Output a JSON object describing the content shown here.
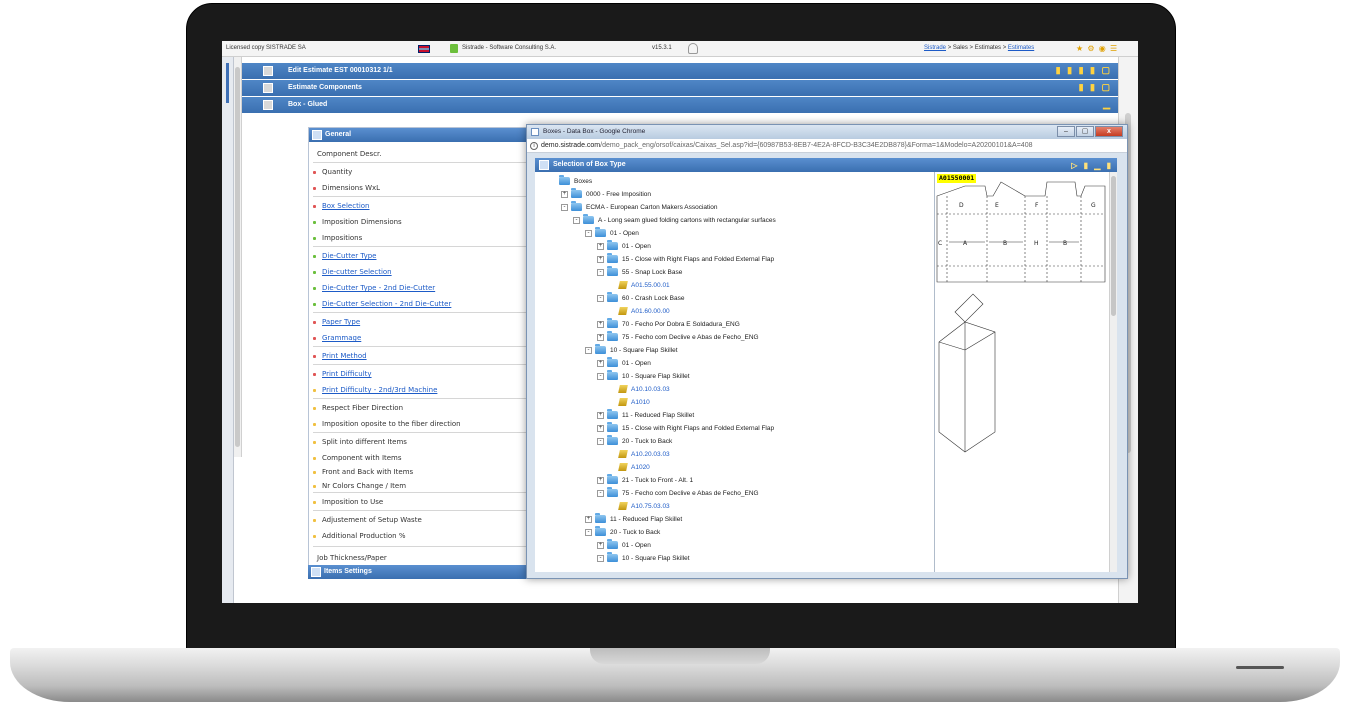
{
  "topbar": {
    "license": "Licensed copy SISTRADE SA",
    "company": "Sistrade - Software Consulting S.A.",
    "version": "v15.3.1",
    "breadcrumb_root": "Sistrade",
    "breadcrumb": "> Sales > Estimates >",
    "breadcrumb_current": "Estimates"
  },
  "headers": {
    "edit_estimate": "Edit Estimate  EST  00010312  1/1",
    "components": "Estimate Components",
    "box_glued": "Box - Glued"
  },
  "panel": {
    "title": "General",
    "items_title": "Items Settings",
    "fields": [
      {
        "label": "Component Descr.",
        "link": false,
        "dot": ""
      },
      {
        "label": "Quantity",
        "link": false,
        "dot": "#e05555"
      },
      {
        "label": "Dimensions WxL",
        "link": false,
        "dot": "#e05555"
      },
      {
        "label": "Box Selection",
        "link": true,
        "dot": "#e05555"
      },
      {
        "label": "Imposition Dimensions",
        "link": false,
        "dot": "#6abf3c"
      },
      {
        "label": "Impositions",
        "link": false,
        "dot": "#6abf3c"
      },
      {
        "label": "Die-Cutter Type",
        "link": true,
        "dot": "#6abf3c"
      },
      {
        "label": "Die-cutter Selection",
        "link": true,
        "dot": "#6abf3c"
      },
      {
        "label": "Die-Cutter Type - 2nd Die-Cutter",
        "link": true,
        "dot": "#6abf3c"
      },
      {
        "label": "Die-Cutter Selection - 2nd Die-Cutter",
        "link": true,
        "dot": "#6abf3c"
      },
      {
        "label": "Paper Type",
        "link": true,
        "dot": "#e05555"
      },
      {
        "label": "Grammage",
        "link": true,
        "dot": "#e05555"
      },
      {
        "label": "Print Method",
        "link": true,
        "dot": "#e05555"
      },
      {
        "label": "Print Difficulty",
        "link": true,
        "dot": "#e05555"
      },
      {
        "label": "Print Difficulty - 2nd/3rd Machine",
        "link": true,
        "dot": "#f0c040"
      },
      {
        "label": "Respect Fiber Direction",
        "link": false,
        "dot": "#f0c040"
      },
      {
        "label": "Imposition oposite to the fiber direction",
        "link": false,
        "dot": "#f0c040"
      },
      {
        "label": "Split into different Items",
        "link": false,
        "dot": "#f0c040"
      },
      {
        "label": "Component with Items",
        "link": false,
        "dot": "#f0c040"
      },
      {
        "label": "Front and Back with Items",
        "link": false,
        "dot": "#f0c040"
      },
      {
        "label": "Nr Colors Change / Item",
        "link": false,
        "dot": "#f0c040"
      },
      {
        "label": "Imposition to Use",
        "link": false,
        "dot": "#f0c040"
      },
      {
        "label": "Adjustement of Setup Waste",
        "link": false,
        "dot": "#f0c040"
      },
      {
        "label": "Additional Production %",
        "link": false,
        "dot": "#f0c040"
      },
      {
        "label": "Job Thickness/Paper",
        "link": false,
        "dot": ""
      }
    ]
  },
  "popup": {
    "window_title": "Boxes - Data Box - Google Chrome",
    "url_domain": "demo.sistrade.com",
    "url_path": "/demo_pack_eng/orsof/caixas/Caixas_Sel.asp?id={60987B53-8EB7-4E2A-8FCD-B3C34E2DB878}&Forma=1&Modelo=A20200101&A=408",
    "section_title": "Selection of Box Type",
    "preview_code": "A01550001",
    "tree": [
      {
        "label": "Boxes",
        "level": 0,
        "exp": "",
        "icon": "folder",
        "code": false
      },
      {
        "label": "0000 - Free Imposition",
        "level": 1,
        "exp": "+",
        "icon": "folder",
        "code": false
      },
      {
        "label": "ECMA - European Carton Makers Association",
        "level": 1,
        "exp": "-",
        "icon": "folder",
        "code": false
      },
      {
        "label": "A - Long seam glued folding cartons with rectangular surfaces",
        "level": 2,
        "exp": "-",
        "icon": "folder",
        "code": false
      },
      {
        "label": "01 - Open",
        "level": 3,
        "exp": "-",
        "icon": "folder",
        "code": false
      },
      {
        "label": "01 - Open",
        "level": 4,
        "exp": "+",
        "icon": "folder",
        "code": false
      },
      {
        "label": "15 - Close with Right Flaps and Folded External Flap",
        "level": 4,
        "exp": "+",
        "icon": "folder",
        "code": false
      },
      {
        "label": "55 - Snap Lock Base",
        "level": 4,
        "exp": "-",
        "icon": "folder",
        "code": false
      },
      {
        "label": "A01.55.00.01",
        "level": 5,
        "exp": "",
        "icon": "leaf",
        "code": true
      },
      {
        "label": "60 - Crash Lock Base",
        "level": 4,
        "exp": "-",
        "icon": "folder",
        "code": false
      },
      {
        "label": "A01.60.00.00",
        "level": 5,
        "exp": "",
        "icon": "leaf",
        "code": true
      },
      {
        "label": "70 - Fecho Por Dobra E Soldadura_ENG",
        "level": 4,
        "exp": "+",
        "icon": "folder",
        "code": false
      },
      {
        "label": "75 - Fecho com Declive e Abas de Fecho_ENG",
        "level": 4,
        "exp": "+",
        "icon": "folder",
        "code": false
      },
      {
        "label": "10 - Square Flap Skillet",
        "level": 3,
        "exp": "-",
        "icon": "folder",
        "code": false
      },
      {
        "label": "01 - Open",
        "level": 4,
        "exp": "+",
        "icon": "folder",
        "code": false
      },
      {
        "label": "10 - Square Flap Skillet",
        "level": 4,
        "exp": "-",
        "icon": "folder",
        "code": false
      },
      {
        "label": "A10.10.03.03",
        "level": 5,
        "exp": "",
        "icon": "leaf",
        "code": true
      },
      {
        "label": "A1010",
        "level": 5,
        "exp": "",
        "icon": "leaf",
        "code": true
      },
      {
        "label": "11 - Reduced Flap Skillet",
        "level": 4,
        "exp": "+",
        "icon": "folder",
        "code": false
      },
      {
        "label": "15 - Close with Right Flaps and Folded External Flap",
        "level": 4,
        "exp": "+",
        "icon": "folder",
        "code": false
      },
      {
        "label": "20 - Tuck to Back",
        "level": 4,
        "exp": "-",
        "icon": "folder",
        "code": false
      },
      {
        "label": "A10.20.03.03",
        "level": 5,
        "exp": "",
        "icon": "leaf",
        "code": true
      },
      {
        "label": "A1020",
        "level": 5,
        "exp": "",
        "icon": "leaf",
        "code": true
      },
      {
        "label": "21 - Tuck to Front - Alt. 1",
        "level": 4,
        "exp": "+",
        "icon": "folder",
        "code": false
      },
      {
        "label": "75 - Fecho com Declive e Abas de Fecho_ENG",
        "level": 4,
        "exp": "-",
        "icon": "folder",
        "code": false
      },
      {
        "label": "A10.75.03.03",
        "level": 5,
        "exp": "",
        "icon": "leaf",
        "code": true
      },
      {
        "label": "11 - Reduced Flap Skillet",
        "level": 3,
        "exp": "+",
        "icon": "folder",
        "code": false
      },
      {
        "label": "20 - Tuck to Back",
        "level": 3,
        "exp": "-",
        "icon": "folder",
        "code": false
      },
      {
        "label": "01 - Open",
        "level": 4,
        "exp": "+",
        "icon": "folder",
        "code": false
      },
      {
        "label": "10 - Square Flap Skillet",
        "level": 4,
        "exp": "-",
        "icon": "folder",
        "code": false
      }
    ]
  }
}
